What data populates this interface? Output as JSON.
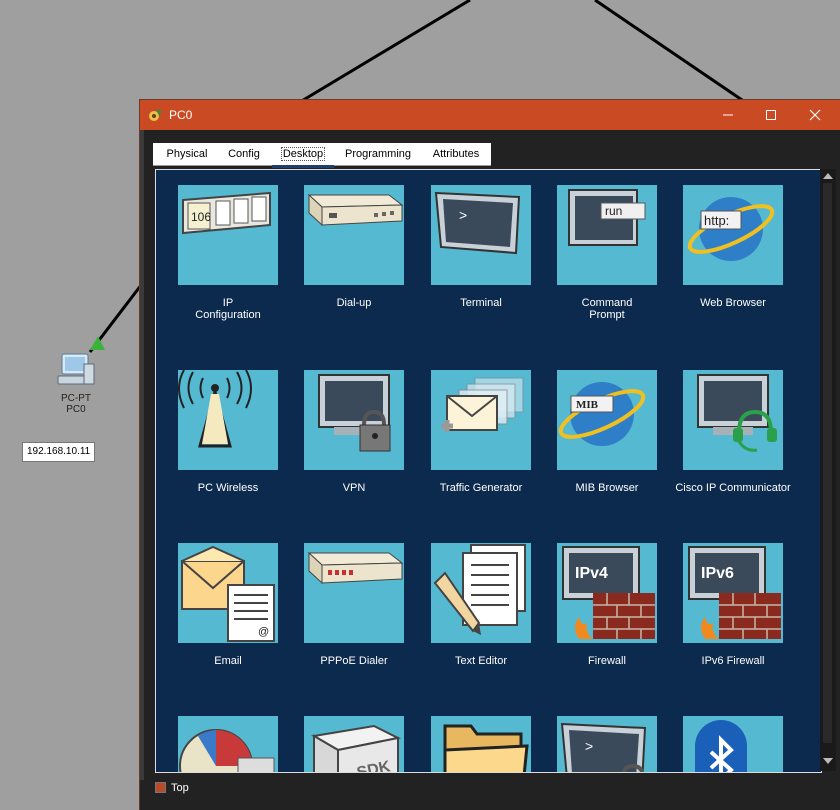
{
  "topology": {
    "device_type": "PC-PT",
    "device_name": "PC0",
    "ip_address": "192.168.10.11"
  },
  "window": {
    "title": "PC0",
    "icons": {
      "app": "packet-tracer-icon",
      "minimize": "minimize-icon",
      "maximize": "maximize-icon",
      "close": "close-icon"
    }
  },
  "tabs": [
    {
      "label": "Physical",
      "active": false
    },
    {
      "label": "Config",
      "active": false
    },
    {
      "label": "Desktop",
      "active": true
    },
    {
      "label": "Programming",
      "active": false
    },
    {
      "label": "Attributes",
      "active": false
    }
  ],
  "apps": [
    {
      "label": "IP\nConfiguration",
      "icon": "ip-configuration-icon"
    },
    {
      "label": "Dial-up",
      "icon": "modem-icon"
    },
    {
      "label": "Terminal",
      "icon": "terminal-icon"
    },
    {
      "label": "Command\nPrompt",
      "icon": "command-prompt-icon"
    },
    {
      "label": "Web Browser",
      "icon": "web-browser-icon"
    },
    {
      "label": "PC Wireless",
      "icon": "wireless-tower-icon"
    },
    {
      "label": "VPN",
      "icon": "vpn-lock-icon"
    },
    {
      "label": "Traffic Generator",
      "icon": "traffic-generator-icon"
    },
    {
      "label": "MIB Browser",
      "icon": "mib-browser-icon"
    },
    {
      "label": "Cisco IP Communicator",
      "icon": "ip-communicator-icon"
    },
    {
      "label": "Email",
      "icon": "email-icon"
    },
    {
      "label": "PPPoE Dialer",
      "icon": "pppoe-modem-icon"
    },
    {
      "label": "Text Editor",
      "icon": "text-editor-icon"
    },
    {
      "label": "Firewall",
      "icon": "firewall-ipv4-icon"
    },
    {
      "label": "IPv6 Firewall",
      "icon": "firewall-ipv6-icon"
    },
    {
      "label": "",
      "icon": "pie-chart-app-icon"
    },
    {
      "label": "",
      "icon": "sdk-box-icon"
    },
    {
      "label": "",
      "icon": "folder-icon"
    },
    {
      "label": "",
      "icon": "terminal-lock-icon"
    },
    {
      "label": "",
      "icon": "bluetooth-icon"
    }
  ],
  "tile_text": {
    "ip_number": "106",
    "run": "run",
    "http": "http:",
    "mib": "MIB",
    "ipv4": "IPv4",
    "ipv6": "IPv6",
    "sdk": "SDK",
    "prompt": ">"
  },
  "footer": {
    "checkbox_label": "Top",
    "checkbox_color": "#b84a2a"
  },
  "colors": {
    "titlebar": "#c94a23",
    "content_bg": "#0c2a4d",
    "tile_bg": "#55b9d2",
    "canvas_bg": "#9f9f9f"
  }
}
